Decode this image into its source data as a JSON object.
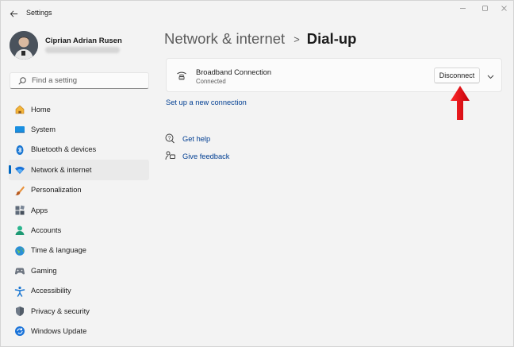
{
  "window": {
    "title": "Settings"
  },
  "profile": {
    "name": "Ciprian Adrian Rusen"
  },
  "search": {
    "placeholder": "Find a setting"
  },
  "nav": {
    "items": [
      {
        "label": "Home",
        "icon": "home-icon"
      },
      {
        "label": "System",
        "icon": "system-icon"
      },
      {
        "label": "Bluetooth & devices",
        "icon": "bluetooth-icon"
      },
      {
        "label": "Network & internet",
        "icon": "network-icon",
        "active": true
      },
      {
        "label": "Personalization",
        "icon": "brush-icon"
      },
      {
        "label": "Apps",
        "icon": "apps-icon"
      },
      {
        "label": "Accounts",
        "icon": "accounts-icon"
      },
      {
        "label": "Time & language",
        "icon": "globe-icon"
      },
      {
        "label": "Gaming",
        "icon": "gaming-icon"
      },
      {
        "label": "Accessibility",
        "icon": "accessibility-icon"
      },
      {
        "label": "Privacy & security",
        "icon": "shield-icon"
      },
      {
        "label": "Windows Update",
        "icon": "update-icon"
      }
    ]
  },
  "breadcrumb": {
    "parent": "Network & internet",
    "separator": ">",
    "current": "Dial-up"
  },
  "connection": {
    "name": "Broadband Connection",
    "status": "Connected",
    "action_label": "Disconnect",
    "icon": "dialup-icon"
  },
  "links": {
    "setup": "Set up a new connection",
    "help": "Get help",
    "feedback": "Give feedback"
  },
  "colors": {
    "accent": "#0067c0",
    "link": "#003e92",
    "annotation_arrow": "#e8141c"
  }
}
